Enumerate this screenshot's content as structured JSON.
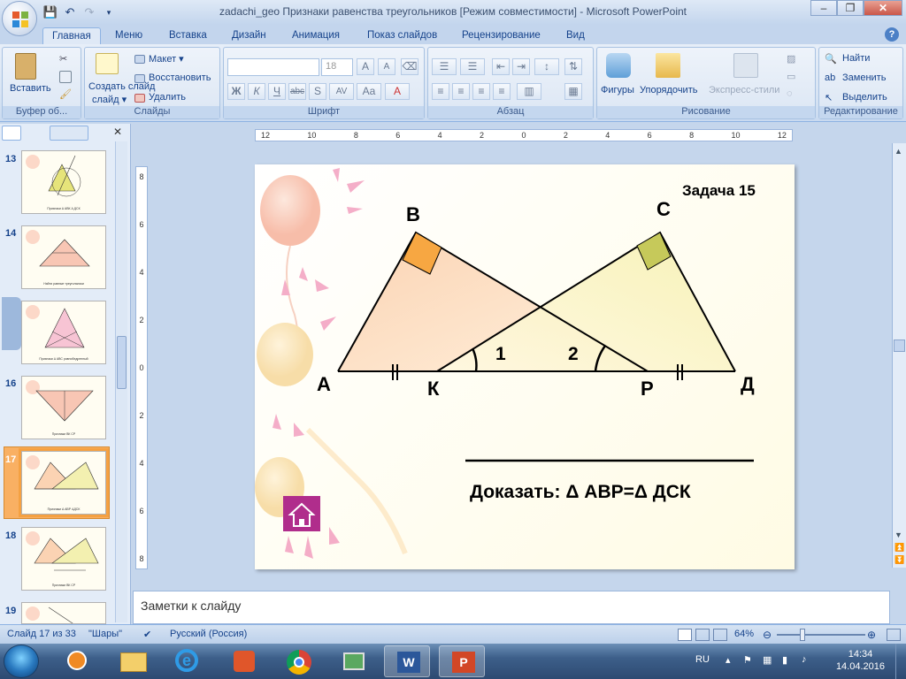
{
  "window": {
    "title": "zadachi_geo Признаки равенства треугольников [Режим совместимости] - Microsoft PowerPoint",
    "minimize": "–",
    "maximize": "❐",
    "close": "✕"
  },
  "tabs": [
    "Главная",
    "Меню",
    "Вставка",
    "Дизайн",
    "Анимация",
    "Показ слайдов",
    "Рецензирование",
    "Вид"
  ],
  "ribbon": {
    "clipboard": {
      "paste": "Вставить",
      "label": "Буфер об..."
    },
    "slides": {
      "create": "Создать слайд",
      "create2": "слайд ▾",
      "layout": "Макет ▾",
      "restore": "Восстановить",
      "delete": "Удалить",
      "label": "Слайды"
    },
    "font": {
      "size": "18",
      "label": "Шрифт",
      "bold": "Ж",
      "italic": "К",
      "underline": "Ч",
      "strike": "abc",
      "shadow": "S",
      "spacing": "AV",
      "case": "Aa",
      "grow": "A",
      "shrink": "A",
      "color": "A"
    },
    "paragraph": {
      "label": "Абзац"
    },
    "drawing": {
      "shapes": "Фигуры",
      "arrange": "Упорядочить",
      "styles": "Экспресс-стили",
      "label": "Рисование"
    },
    "editing": {
      "find": "Найти",
      "replace": "Заменить",
      "select": "Выделить",
      "label": "Редактирование"
    }
  },
  "thumbnails": [
    {
      "num": "13",
      "caption": "Признаки Δ АВК Δ ДСК"
    },
    {
      "num": "14",
      "caption": "Найти равные треугольники"
    },
    {
      "num": "15",
      "caption": "Признаки Δ АВС равнобедренный"
    },
    {
      "num": "16",
      "caption": "Признаки ВК СР"
    },
    {
      "num": "17",
      "caption": "Признаки Δ АВР ΔДСК"
    },
    {
      "num": "18",
      "caption": "Признаки ВК СР"
    },
    {
      "num": "19",
      "caption": ""
    }
  ],
  "ruler": {
    "h": [
      "12",
      "10",
      "8",
      "6",
      "4",
      "2",
      "0",
      "2",
      "4",
      "6",
      "8",
      "10",
      "12"
    ],
    "v": [
      "8",
      "6",
      "4",
      "2",
      "0",
      "2",
      "4",
      "6",
      "8"
    ]
  },
  "slide": {
    "task": "Задача 15",
    "points": {
      "A": "А",
      "B": "В",
      "C": "С",
      "D": "Д",
      "K": "К",
      "P": "Р"
    },
    "angle1": "1",
    "angle2": "2",
    "prove": "Доказать: Δ АВР=Δ ДСК"
  },
  "notes": {
    "placeholder": "Заметки к слайду"
  },
  "status": {
    "slide": "Слайд 17 из 33",
    "theme": "\"Шары\"",
    "lang": "Русский (Россия)",
    "zoom": "64%"
  },
  "taskbar": {
    "lang": "RU",
    "time": "14:34",
    "date": "14.04.2016"
  },
  "colors": {
    "accent": "#15428b",
    "angleB": "#f7a742",
    "angleC": "#c6c95a",
    "home": "#b02d8c"
  }
}
